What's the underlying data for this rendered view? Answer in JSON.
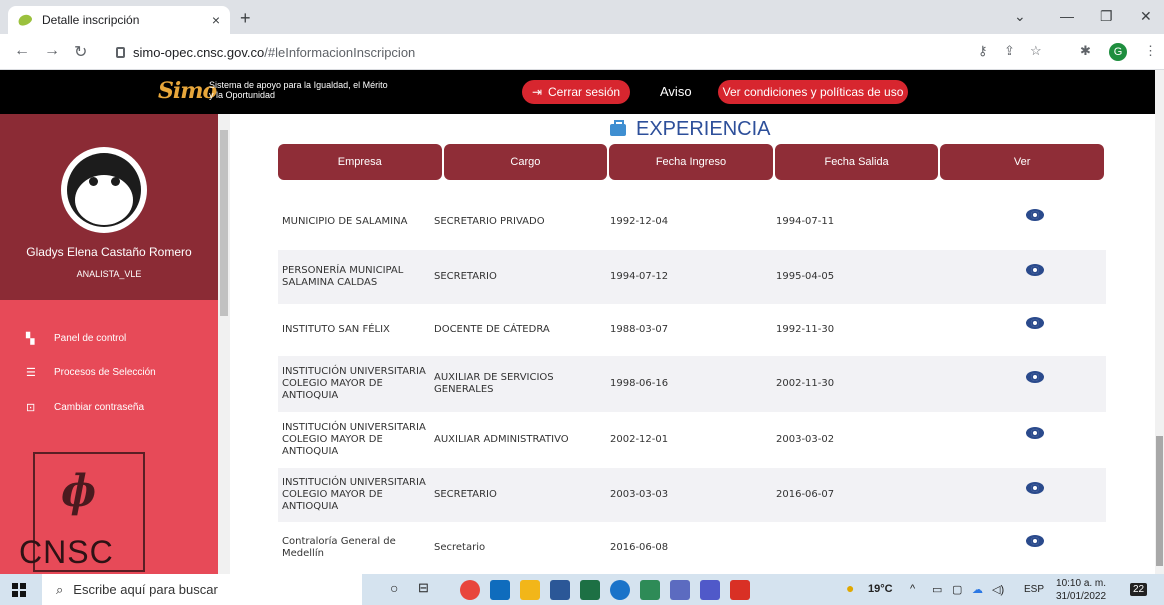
{
  "browser": {
    "tab_title": "Detalle inscripción",
    "tab_close": "×",
    "new_tab": "+",
    "url_host": "simo-opec.cnsc.gov.co",
    "url_path": "/#leInformacionInscripcion",
    "profile_initial": "G"
  },
  "header": {
    "logo": "Simo",
    "tagline": "Sistema de apoyo para la Igualdad, el Mérito y la Oportunidad",
    "logout_label": "Cerrar sesión",
    "notice_label": "Aviso",
    "terms_label": "Ver condiciones y políticas de uso"
  },
  "sidebar": {
    "user_name": "Gladys Elena Castaño Romero",
    "user_role": "ANALISTA_VLE",
    "items": [
      {
        "label": "Panel de control",
        "icon": "dashboard-icon"
      },
      {
        "label": "Procesos de Selección",
        "icon": "list-icon"
      },
      {
        "label": "Cambiar contraseña",
        "icon": "lock-icon"
      }
    ],
    "brand_text": "CNSC"
  },
  "main": {
    "section_title": "EXPERIENCIA",
    "columns": [
      "Empresa",
      "Cargo",
      "Fecha Ingreso",
      "Fecha Salida",
      "Ver"
    ],
    "rows": [
      {
        "empresa": "MUNICIPIO DE SALAMINA",
        "cargo": "SECRETARIO PRIVADO",
        "ingreso": "1992-12-04",
        "salida": "1994-07-11"
      },
      {
        "empresa": "PERSONERÍA MUNICIPAL SALAMINA CALDAS",
        "cargo": "SECRETARIO",
        "ingreso": "1994-07-12",
        "salida": "1995-04-05"
      },
      {
        "empresa": "INSTITUTO SAN FÉLIX",
        "cargo": "DOCENTE DE CÁTEDRA",
        "ingreso": "1988-03-07",
        "salida": "1992-11-30"
      },
      {
        "empresa": "INSTITUCIÓN UNIVERSITARIA COLEGIO MAYOR DE ANTIOQUIA",
        "cargo": "AUXILIAR DE SERVICIOS GENERALES",
        "ingreso": "1998-06-16",
        "salida": "2002-11-30"
      },
      {
        "empresa": "INSTITUCIÓN UNIVERSITARIA COLEGIO MAYOR DE ANTIOQUIA",
        "cargo": "AUXILIAR ADMINISTRATIVO",
        "ingreso": "2002-12-01",
        "salida": "2003-03-02"
      },
      {
        "empresa": "INSTITUCIÓN UNIVERSITARIA COLEGIO MAYOR DE ANTIOQUIA",
        "cargo": "SECRETARIO",
        "ingreso": "2003-03-03",
        "salida": "2016-06-07"
      },
      {
        "empresa": "Contraloría General de Medellín",
        "cargo": "Secretario",
        "ingreso": "2016-06-08",
        "salida": ""
      }
    ]
  },
  "taskbar": {
    "search_placeholder": "Escribe aquí para buscar",
    "weather": "19°C",
    "language": "ESP",
    "time": "10:10 a. m.",
    "date": "31/01/2022",
    "notifications": "22"
  },
  "colors": {
    "header_bg": "#000000",
    "sidebar_bg": "#e74a58",
    "profile_bg": "#8b2b35",
    "table_header_bg": "#8f2d37",
    "accent_blue": "#2d4f9a",
    "button_red": "#d7262f"
  }
}
